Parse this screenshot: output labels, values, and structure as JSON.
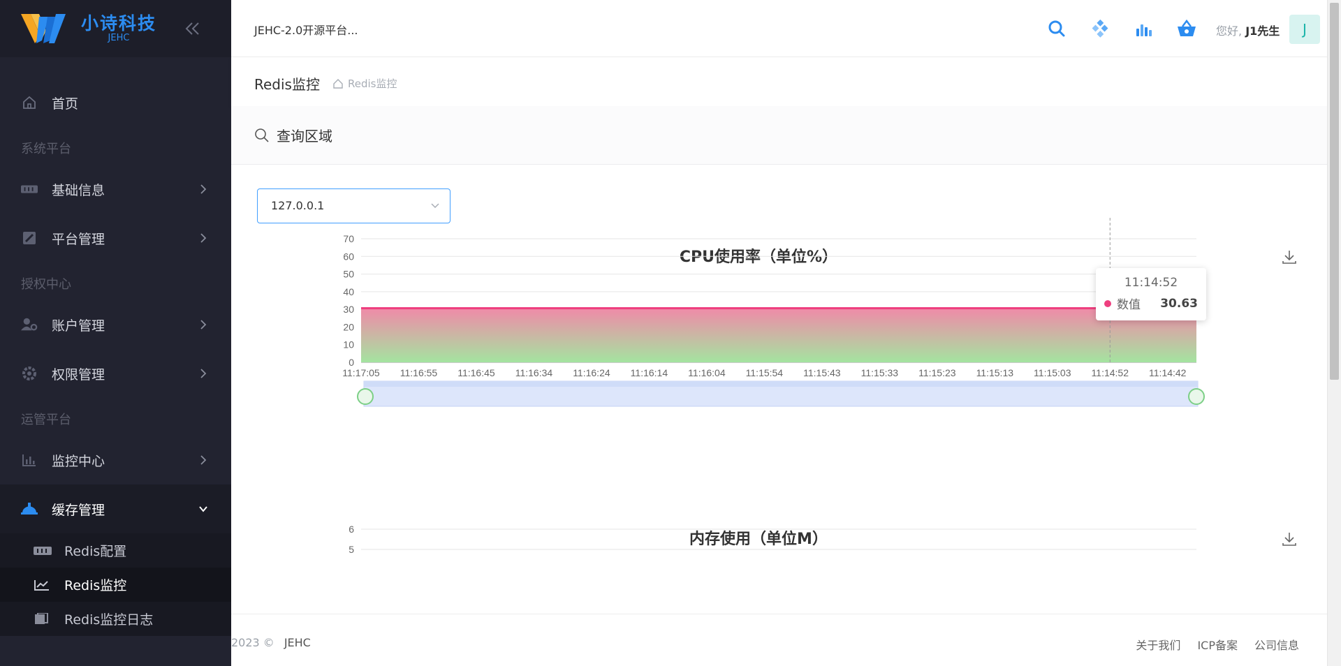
{
  "brand": {
    "name": "小诗科技",
    "sub": "JEHC",
    "accent": "#2c8cf0"
  },
  "sidebar": {
    "home": {
      "label": "首页",
      "icon": "home-icon"
    },
    "groups": [
      {
        "title": "系统平台",
        "items": [
          {
            "label": "基础信息",
            "icon": "grid-icon"
          },
          {
            "label": "平台管理",
            "icon": "settings-box-icon"
          }
        ]
      },
      {
        "title": "授权中心",
        "items": [
          {
            "label": "账户管理",
            "icon": "user-gear-icon"
          },
          {
            "label": "权限管理",
            "icon": "gear-icon"
          }
        ]
      },
      {
        "title": "运管平台",
        "items": [
          {
            "label": "监控中心",
            "icon": "bar-chart-icon"
          },
          {
            "label": "缓存管理",
            "icon": "cloud-icon"
          }
        ]
      }
    ],
    "submenu": [
      {
        "label": "Redis配置",
        "icon": "grid-icon"
      },
      {
        "label": "Redis监控",
        "icon": "trend-icon",
        "active": true
      },
      {
        "label": "Redis监控日志",
        "icon": "log-icon"
      }
    ]
  },
  "header": {
    "site_name": "JEHC-2.0开源平台...",
    "greeting_prefix": "您好,",
    "user_name": "J1先生",
    "avatar_letter": "J"
  },
  "page": {
    "title": "Redis监控",
    "breadcrumb": "Redis监控"
  },
  "search": {
    "label": "查询区域",
    "selected_host": "127.0.0.1"
  },
  "chart_data": [
    {
      "type": "area",
      "title": "CPU使用率（单位%）",
      "x": [
        "11:17:05",
        "11:16:55",
        "11:16:45",
        "11:16:34",
        "11:16:24",
        "11:16:14",
        "11:16:04",
        "11:15:54",
        "11:15:43",
        "11:15:33",
        "11:15:23",
        "11:15:13",
        "11:15:03",
        "11:14:52",
        "11:14:42"
      ],
      "series": [
        {
          "name": "数值",
          "values": [
            30.63,
            30.63,
            30.63,
            30.63,
            30.63,
            30.63,
            30.63,
            30.63,
            30.63,
            30.63,
            30.63,
            30.63,
            30.63,
            30.63,
            30.63
          ]
        }
      ],
      "y_ticks": [
        0,
        10,
        20,
        30,
        40,
        50,
        60,
        70
      ],
      "ylim": [
        0,
        70
      ],
      "tooltip": {
        "time": "11:14:52",
        "series": "数值",
        "value": "30.63"
      },
      "colors": {
        "line": "#ee3f7f",
        "fill_top": "#f08aa8",
        "fill_bottom": "#a4e4a0"
      }
    },
    {
      "type": "area",
      "title": "内存使用（单位M）",
      "y_ticks": [
        5,
        6
      ]
    }
  ],
  "footer": {
    "copyright": "2023 ©",
    "brand": "JEHC",
    "links": [
      "关于我们",
      "ICP备案",
      "公司信息"
    ]
  }
}
